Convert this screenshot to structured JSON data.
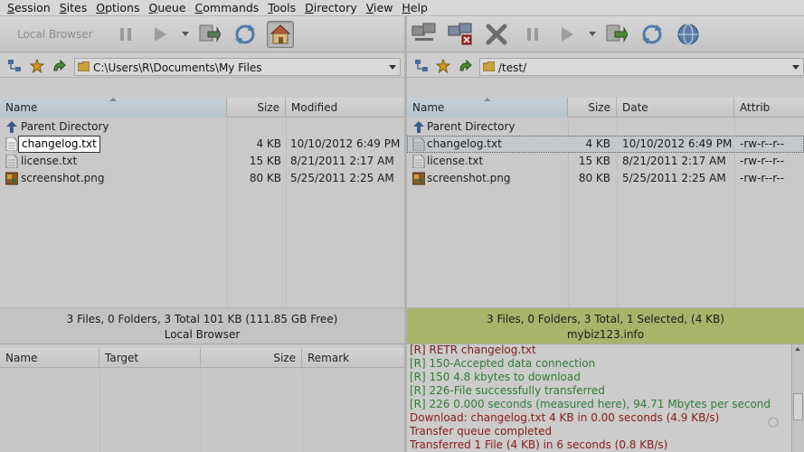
{
  "menu": [
    "Session",
    "Sites",
    "Options",
    "Queue",
    "Commands",
    "Tools",
    "Directory",
    "View",
    "Help"
  ],
  "left": {
    "toolbar_label": "Local Browser",
    "path": "C:\\Users\\R\\Documents\\My Files",
    "columns": [
      "Name",
      "Size",
      "Modified"
    ],
    "parent": "Parent Directory",
    "files": [
      {
        "name": "changelog.txt",
        "size": "4 KB",
        "modified": "10/10/2012 6:49 PM",
        "icon": "text-file-icon"
      },
      {
        "name": "license.txt",
        "size": "15 KB",
        "modified": "8/21/2011 2:17 AM",
        "icon": "text-file-icon"
      },
      {
        "name": "screenshot.png",
        "size": "80 KB",
        "modified": "5/25/2011 2:25 AM",
        "icon": "image-file-icon"
      }
    ],
    "status": "3 Files, 0 Folders, 3 Total 101 KB (111.85 GB Free)",
    "status_name": "Local Browser"
  },
  "right": {
    "path": "/test/",
    "columns": [
      "Name",
      "Size",
      "Date",
      "Attrib"
    ],
    "parent": "Parent Directory",
    "files": [
      {
        "name": "changelog.txt",
        "size": "4 KB",
        "date": "10/10/2012 6:49 PM",
        "attrib": "-rw-r--r--",
        "icon": "text-file-icon"
      },
      {
        "name": "license.txt",
        "size": "15 KB",
        "date": "8/21/2011 2:17 AM",
        "attrib": "-rw-r--r--",
        "icon": "text-file-icon"
      },
      {
        "name": "screenshot.png",
        "size": "80 KB",
        "date": "5/25/2011 2:25 AM",
        "attrib": "-rw-r--r--",
        "icon": "image-file-icon"
      }
    ],
    "status": "3 Files, 0 Folders, 3 Total, 1 Selected, (4 KB)",
    "status_name": "mybiz123.info",
    "status_color": "#a8b46a"
  },
  "queue": {
    "columns": [
      "Name",
      "Target",
      "Size",
      "Remark"
    ]
  },
  "log": [
    {
      "text": "[R] RETR changelog.txt",
      "color": "#7a1d1d"
    },
    {
      "text": "[R] 150-Accepted data connection",
      "color": "#2e7d32"
    },
    {
      "text": "[R] 150 4.8 kbytes to download",
      "color": "#2e7d32"
    },
    {
      "text": "[R] 226-File successfully transferred",
      "color": "#2e7d32"
    },
    {
      "text": "[R] 226 0.000 seconds (measured here), 94.71 Mbytes per second",
      "color": "#2e7d32"
    },
    {
      "text": "Download: changelog.txt 4 KB in 0.00 seconds (4.9 KB/s)",
      "color": "#8b1a1a"
    },
    {
      "text": "Transfer queue completed",
      "color": "#8b1a1a"
    },
    {
      "text": "Transferred 1 File (4 KB) in 6 seconds (0.8 KB/s)",
      "color": "#8b1a1a"
    }
  ]
}
